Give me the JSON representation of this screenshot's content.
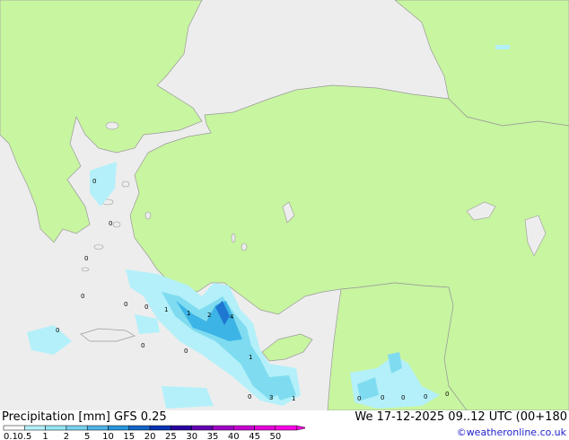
{
  "header": {
    "title": "Precipitation [mm]  GFS 0.25",
    "datetime": "We 17-12-2025 09..12 UTC (00+180",
    "credit": "©weatheronline.co.uk"
  },
  "colors": {
    "land": "#c8f5a0",
    "sea": "#ededed",
    "border": "#9a9a9a",
    "precip_light": "#b4f0fa",
    "precip_mid": "#7fdcf0",
    "precip_heavy": "#3cb4e6",
    "precip_core": "#1e78d2"
  },
  "legend": {
    "labels": [
      "0.1",
      "0.5",
      "1",
      "2",
      "5",
      "10",
      "15",
      "20",
      "25",
      "30",
      "35",
      "40",
      "45",
      "50"
    ],
    "colors": [
      "#ffffff",
      "#b4f0fa",
      "#96e6f5",
      "#78d2f0",
      "#50b4e6",
      "#2896dc",
      "#1464c8",
      "#0a32b4",
      "#2800a0",
      "#6400b4",
      "#a000c8",
      "#c800d2",
      "#e600dc",
      "#ff00e6"
    ]
  },
  "map_values": [
    {
      "text": "0"
    },
    {
      "text": "0"
    },
    {
      "text": "0"
    },
    {
      "text": "0"
    },
    {
      "text": "0"
    },
    {
      "text": "0"
    },
    {
      "text": "0"
    },
    {
      "text": "1"
    },
    {
      "text": "1"
    },
    {
      "text": "2"
    },
    {
      "text": "4"
    },
    {
      "text": "0"
    },
    {
      "text": "1"
    },
    {
      "text": "0"
    },
    {
      "text": "3"
    },
    {
      "text": "1"
    },
    {
      "text": "0"
    },
    {
      "text": "0"
    },
    {
      "text": "0"
    },
    {
      "text": "0"
    },
    {
      "text": "0"
    },
    {
      "text": "0"
    }
  ]
}
